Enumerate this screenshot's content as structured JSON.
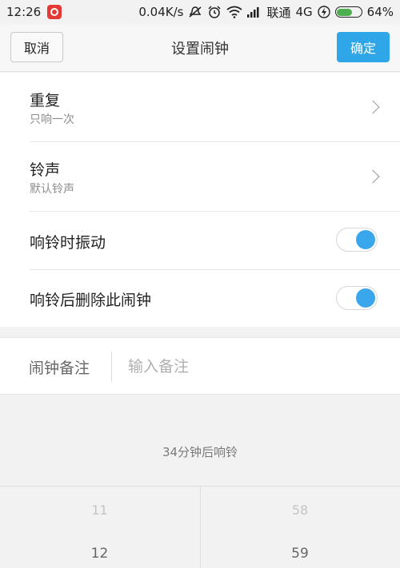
{
  "status_bar": {
    "time": "12:26",
    "net_speed": "0.04K/s",
    "carrier": "联通",
    "network": "4G",
    "battery": "64%",
    "battery_level": 0.64,
    "icons": [
      "netease-music-icon",
      "mute-icon",
      "alarm-icon",
      "wifi-icon",
      "signal-icon",
      "charging-icon",
      "battery-icon"
    ]
  },
  "header": {
    "cancel_label": "取消",
    "title": "设置闹钟",
    "confirm_label": "确定",
    "accent_color": "#2ea6e8"
  },
  "settings": {
    "repeat": {
      "label": "重复",
      "value": "只响一次"
    },
    "ringtone": {
      "label": "铃声",
      "value": "默认铃声"
    },
    "vibrate": {
      "label": "响铃时振动",
      "on": true
    },
    "delete_after": {
      "label": "响铃后删除此闹钟",
      "on": true
    }
  },
  "note": {
    "label": "闹钟备注",
    "placeholder": "输入备注",
    "value": ""
  },
  "hint": "34分钟后响铃",
  "picker": {
    "hours_prev": "11",
    "hours_current": "12",
    "minutes_prev": "58",
    "minutes_current": "59"
  }
}
